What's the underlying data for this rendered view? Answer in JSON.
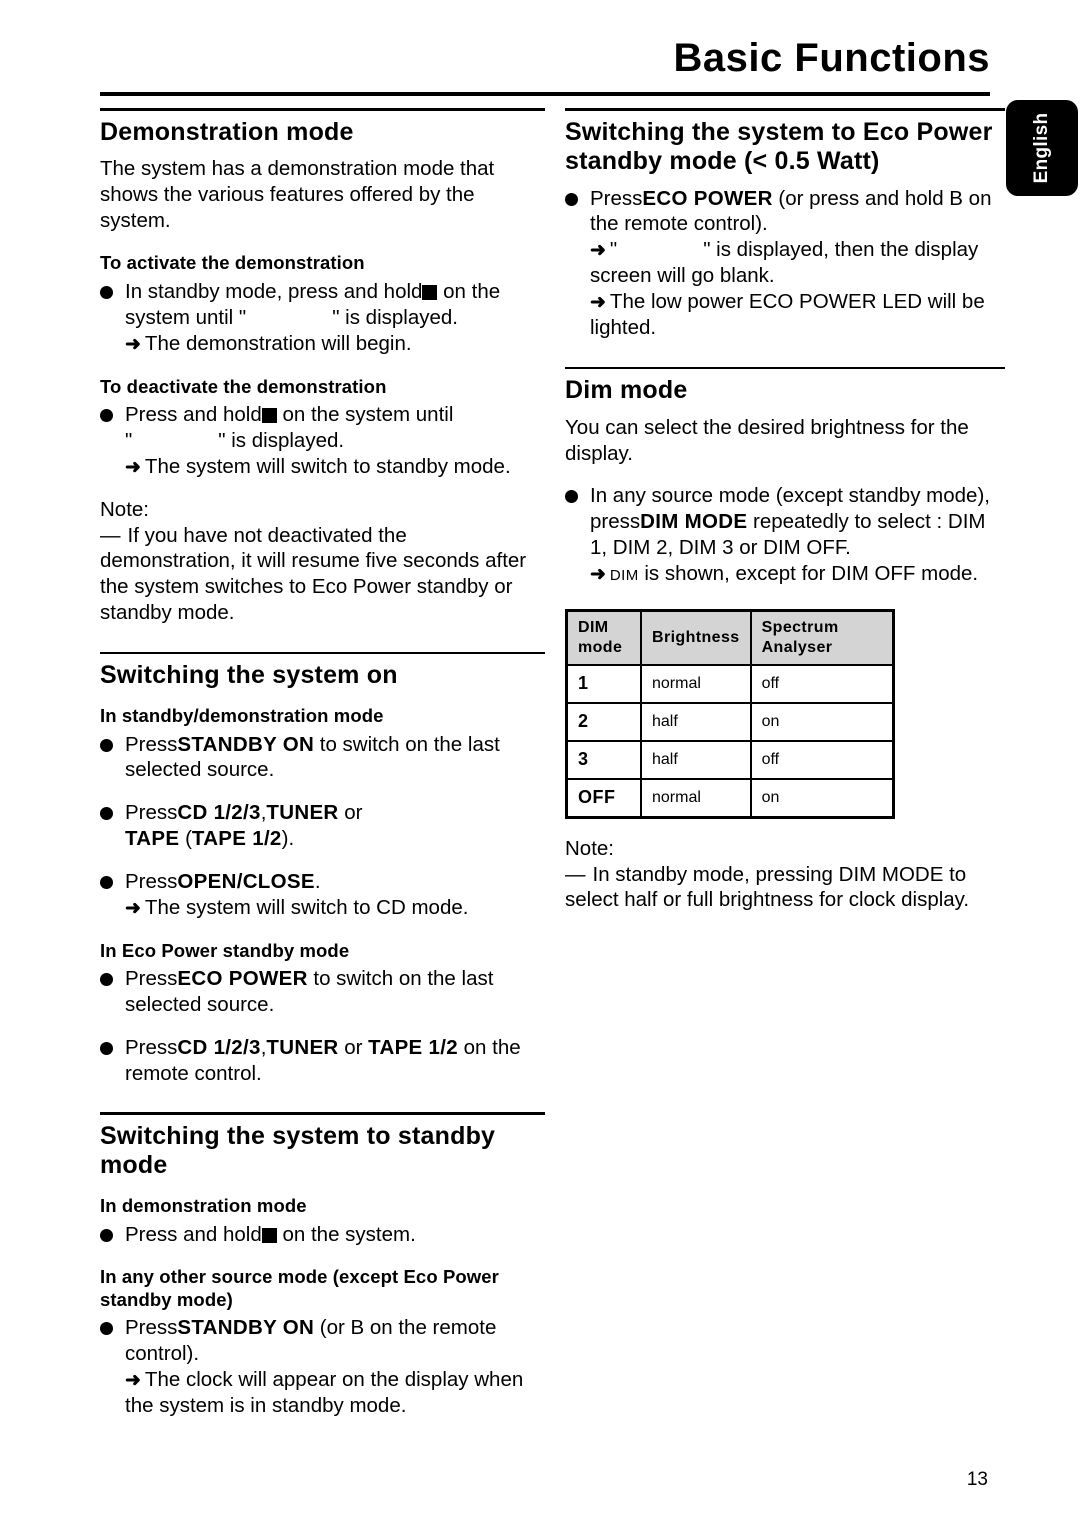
{
  "header": {
    "title": "Basic Functions",
    "language_tab": "English"
  },
  "footer": {
    "page_number": "13"
  },
  "left_column": {
    "demonstration_mode": {
      "heading": "Demonstration mode",
      "intro": "The system has a demonstration mode that shows the various features offered by the system.",
      "activate": {
        "heading": "To activate the demonstration",
        "item_pre": "In standby mode, press and hold",
        "item_mid": "on the",
        "item_line2_pre": "system until \"",
        "item_line2_post": "\" is displayed.",
        "arrow": "The demonstration will begin."
      },
      "deactivate": {
        "heading": "To deactivate the demonstration",
        "item_pre": "Press and hold",
        "item_mid": "on the system until",
        "item_line2_pre": "\"",
        "item_line2_post": "\" is displayed.",
        "arrow": "The system will switch to standby mode."
      },
      "note_label": "Note:",
      "note_dash": "—",
      "note_text": "If you have not deactivated the demonstration, it will resume five seconds after the system switches to Eco Power standby or standby mode."
    },
    "switching_on": {
      "heading": "Switching the system on",
      "standby_demo": {
        "heading": "In standby/demonstration mode",
        "item1_pre": "Press",
        "item1_bold": "STANDBY ON",
        "item1_post": "to switch on the last selected source.",
        "item2_pre": "Press",
        "item2_bold1": "CD 1/2/3",
        "item2_sep": ",",
        "item2_bold2": "TUNER",
        "item2_mid": "or",
        "item2_bold3": "TAPE",
        "item2_paren_open": "(",
        "item2_bold4": "TAPE 1/2",
        "item2_paren_close": ").",
        "item3_pre": "Press",
        "item3_bold": "OPEN/CLOSE",
        "item3_post": ".",
        "item3_arrow": "The system will switch to CD mode."
      },
      "eco_standby": {
        "heading": "In Eco Power standby mode",
        "item1_pre": "Press",
        "item1_bold": "ECO POWER",
        "item1_post": "to switch on the last selected source.",
        "item2_pre": "Press",
        "item2_bold1": "CD 1/2/3",
        "item2_sep": ",",
        "item2_bold2": "TUNER",
        "item2_mid": "or",
        "item2_bold3": "TAPE 1/2",
        "item2_post": "on the remote control."
      }
    },
    "switching_standby": {
      "heading": "Switching the system to standby mode",
      "demo_mode": {
        "heading": "In demonstration mode",
        "item_pre": "Press and hold",
        "item_post": "on the system."
      },
      "other_mode": {
        "heading": "In any other source mode (except Eco Power standby mode)",
        "item_pre": "Press",
        "item_bold": "STANDBY ON",
        "item_post": "(or B  on the remote control).",
        "arrow": "The clock will appear on the display when the system is in standby mode."
      }
    }
  },
  "right_column": {
    "eco_power": {
      "heading": "Switching the system to Eco Power standby mode (< 0.5 Watt)",
      "item_pre": "Press",
      "item_bold": "ECO POWER",
      "item_post": "(or press and hold B  on the remote control).",
      "arrow1_pre": "\"",
      "arrow1_post": "\" is displayed, then the display screen will go blank.",
      "arrow2": "The low power ECO POWER LED will be lighted."
    },
    "dim_mode": {
      "heading": "Dim mode",
      "intro": "You can select the desired brightness for the display.",
      "item_pre": "In any source mode (except standby mode), press",
      "item_bold": "DIM MODE",
      "item_post": "repeatedly to select : DIM 1, DIM 2, DIM 3 or DIM OFF.",
      "arrow_smallcaps": "DIM",
      "arrow_post": "is shown, except for DIM OFF mode.",
      "note_label": "Note:",
      "note_dash": "—",
      "note_text": "In standby mode, pressing DIM MODE to select half or full brightness for clock display."
    },
    "table": {
      "headers": [
        "DIM mode",
        "Brightness",
        "Spectrum Analyser"
      ],
      "rows": [
        {
          "mode": "1",
          "brightness": "normal",
          "spectrum": "off"
        },
        {
          "mode": "2",
          "brightness": "half",
          "spectrum": "on"
        },
        {
          "mode": "3",
          "brightness": "half",
          "spectrum": "off"
        },
        {
          "mode": "OFF",
          "brightness": "normal",
          "spectrum": "on"
        }
      ]
    }
  },
  "icons": {
    "bullet": "filled-circle-bullet",
    "arrow": "➜",
    "missing_glyph": "filled-square-glyph"
  }
}
